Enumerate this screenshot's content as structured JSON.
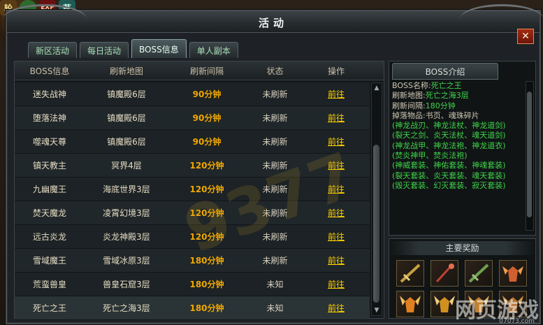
{
  "hud": {
    "icons": [
      {
        "label": "轮",
        "icon": "round-badge-icon"
      },
      {
        "label": "",
        "icon": "green-orb-icon"
      },
      {
        "label": "EXP",
        "icon": "exp-icon"
      },
      {
        "label": "萏",
        "icon": "guild-icon"
      }
    ]
  },
  "window": {
    "title": "活动",
    "close_label": "✕"
  },
  "tabs": [
    {
      "label": "新区活动"
    },
    {
      "label": "每日活动"
    },
    {
      "label": "BOSS信息",
      "active": true
    },
    {
      "label": "单人副本"
    }
  ],
  "table": {
    "headers": {
      "boss": "BOSS信息",
      "map": "刷新地图",
      "interval": "刷新间隔",
      "status": "状态",
      "op": "操作"
    },
    "rows": [
      {
        "boss": "迷失战神",
        "map": "镇魔殿6层",
        "interval": "90分钟",
        "status": "未刷新",
        "op": "前往"
      },
      {
        "boss": "堕落法神",
        "map": "镇魔殿6层",
        "interval": "90分钟",
        "status": "未刷新",
        "op": "前往"
      },
      {
        "boss": "噬魂天尊",
        "map": "镇魔殿6层",
        "interval": "90分钟",
        "status": "未刷新",
        "op": "前往"
      },
      {
        "boss": "镇天教主",
        "map": "冥界4层",
        "interval": "120分钟",
        "status": "未刷新",
        "op": "前往"
      },
      {
        "boss": "九幽魔王",
        "map": "海底世界3层",
        "interval": "120分钟",
        "status": "未刷新",
        "op": "前往"
      },
      {
        "boss": "焚天魔龙",
        "map": "凌霄幻境3层",
        "interval": "120分钟",
        "status": "未刷新",
        "op": "前往"
      },
      {
        "boss": "远古炎龙",
        "map": "炎龙神殿3层",
        "interval": "120分钟",
        "status": "未刷新",
        "op": "前往"
      },
      {
        "boss": "雪域魔王",
        "map": "雪域冰原3层",
        "interval": "180分钟",
        "status": "未刷新",
        "op": "前往"
      },
      {
        "boss": "荒蛮兽皇",
        "map": "兽皇石窟3层",
        "interval": "180分钟",
        "status": "未知",
        "op": "前往"
      },
      {
        "boss": "死亡之王",
        "map": "死亡之海3层",
        "interval": "180分钟",
        "status": "未知",
        "op": "前往"
      }
    ]
  },
  "watermark": "9377",
  "info": {
    "tab_label": "BOSS介绍",
    "name_label": "BOSS名称:",
    "name_value": "死亡之王",
    "map_label": "刷新地图:",
    "map_value": "死亡之海3层",
    "interval_label": "刷新间隔:",
    "interval_value": "180分钟",
    "drops_label": "掉落物品:",
    "drops_value": "书页、魂珠碎片",
    "drops": [
      "(神龙战刃、神龙法杖、神龙道剑)",
      "(裂天之剑、炎天法杖、魂天道剑)",
      "(神龙战甲、神龙法袍、神龙道衣)",
      "(焚炎神甲、焚炎法袍)",
      "(神威套装、神佑套装、神魂套装)",
      "(裂天套装、炎天套装、魂天套装)",
      "(毁灭套装、幻灭套装、寂灭套装)"
    ]
  },
  "rewards": {
    "title": "主要奖励",
    "items": [
      {
        "icon": "gold-sword-icon",
        "color": "#c8a040"
      },
      {
        "icon": "red-staff-icon",
        "color": "#c04030"
      },
      {
        "icon": "green-blade-icon",
        "color": "#70a050"
      },
      {
        "icon": "winged-armor-icon",
        "color": "#d06030"
      },
      {
        "icon": "flame-armor-icon",
        "color": "#e08020"
      },
      {
        "icon": "flame-armor-icon",
        "color": "#d09020"
      },
      {
        "icon": "flame-armor-icon",
        "color": "#c08030"
      },
      {
        "icon": "flame-armor-icon",
        "color": "#b07030"
      }
    ]
  },
  "branding": {
    "main": "网页游戏",
    "sub": "07073.com"
  }
}
